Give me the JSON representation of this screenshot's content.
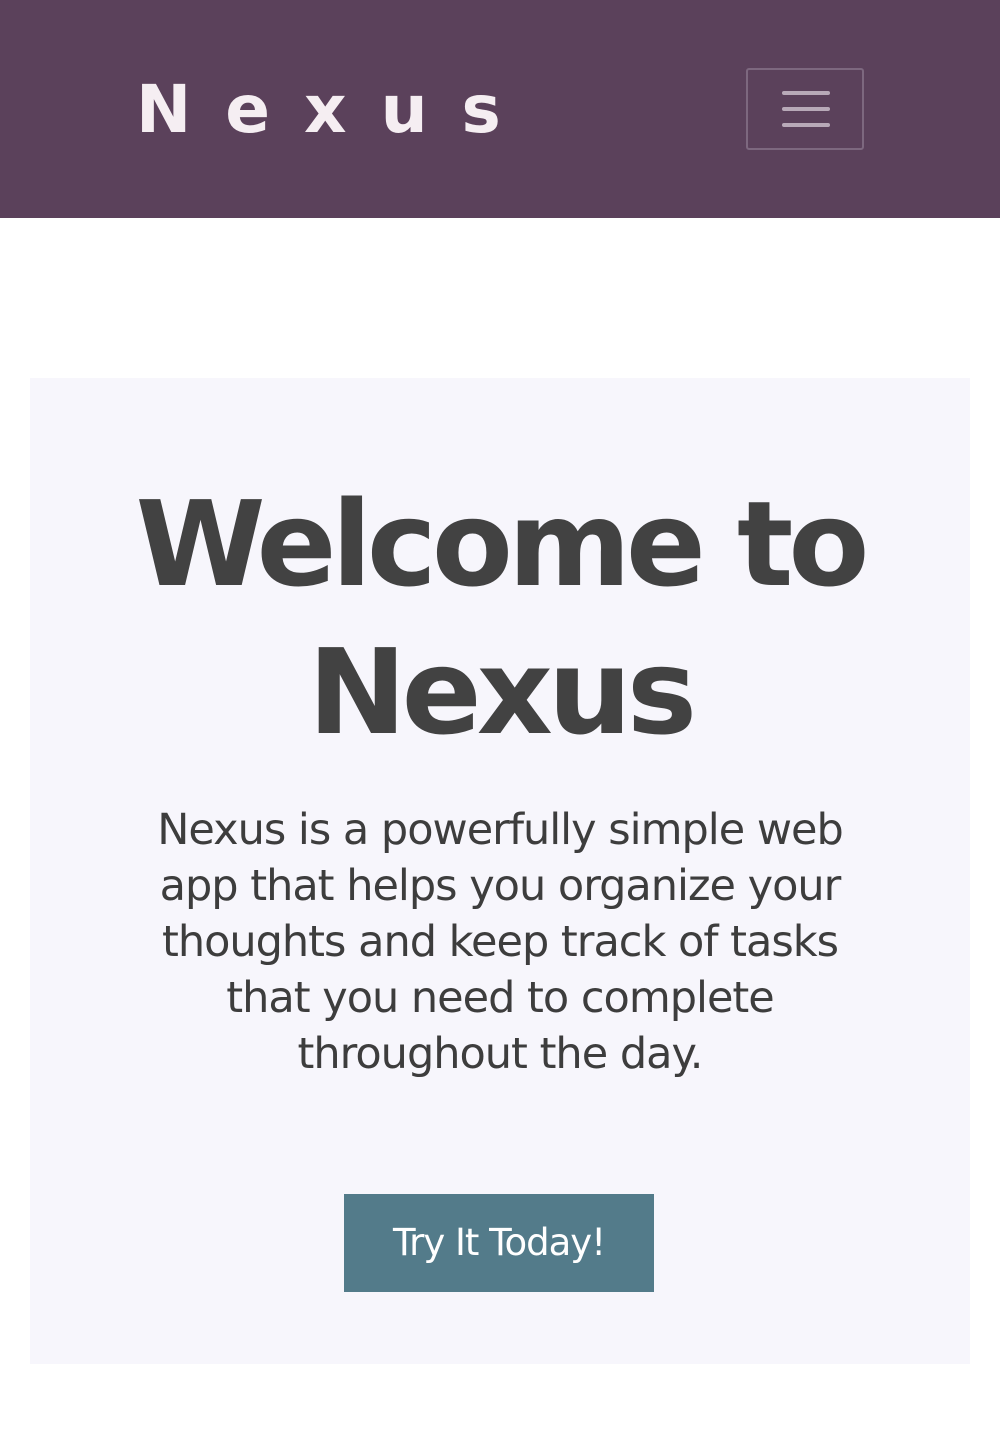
{
  "navbar": {
    "brand": "Nexus",
    "menu_icon": "hamburger-menu-icon",
    "background_color": "#5b415b"
  },
  "hero": {
    "title": "Welcome to Nexus",
    "description": "Nexus is a powerfully simple web app that helps you organize your thoughts and keep track of tasks that you need to complete throughout the day.",
    "cta_label": "Try It Today!",
    "background_color": "#f7f6fc",
    "cta_color": "#537b8a"
  }
}
